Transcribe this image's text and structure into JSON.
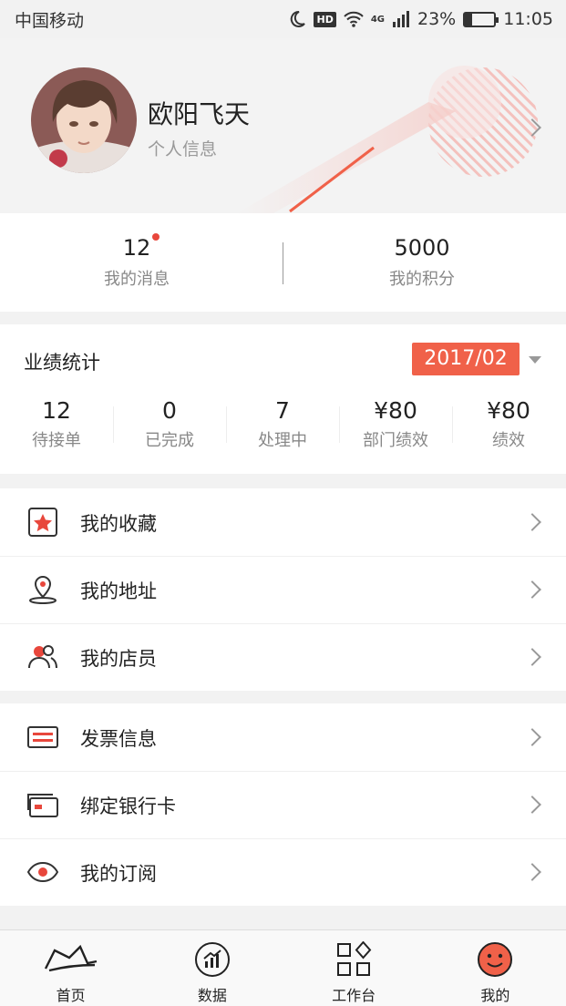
{
  "status_bar": {
    "carrier": "中国移动",
    "hd": "HD",
    "network": "4G",
    "battery_percent": "23%",
    "battery_level": 0.23,
    "time": "11:05"
  },
  "profile": {
    "name": "欧阳飞天",
    "subtitle": "个人信息"
  },
  "stats": [
    {
      "value": "12",
      "label": "我的消息",
      "has_dot": true
    },
    {
      "value": "5000",
      "label": "我的积分",
      "has_dot": false
    }
  ],
  "performance": {
    "title": "业绩统计",
    "date": "2017/02",
    "metrics": [
      {
        "value": "12",
        "label": "待接单"
      },
      {
        "value": "0",
        "label": "已完成"
      },
      {
        "value": "7",
        "label": "处理中"
      },
      {
        "value": "¥80",
        "label": "部门绩效"
      },
      {
        "value": "¥80",
        "label": "绩效"
      }
    ]
  },
  "menu_group_1": [
    {
      "label": "我的收藏",
      "icon": "star-icon"
    },
    {
      "label": "我的地址",
      "icon": "location-pin-icon"
    },
    {
      "label": "我的店员",
      "icon": "staff-icon"
    }
  ],
  "menu_group_2": [
    {
      "label": "发票信息",
      "icon": "invoice-icon"
    },
    {
      "label": "绑定银行卡",
      "icon": "bank-card-icon"
    },
    {
      "label": "我的订阅",
      "icon": "eye-icon"
    }
  ],
  "tabbar": [
    {
      "label": "首页",
      "icon": "home-hat-icon",
      "active": false
    },
    {
      "label": "数据",
      "icon": "data-chart-icon",
      "active": false
    },
    {
      "label": "工作台",
      "icon": "workbench-grid-icon",
      "active": false
    },
    {
      "label": "我的",
      "icon": "smiley-icon",
      "active": true
    }
  ],
  "colors": {
    "accent": "#f06149",
    "dot": "#e8473c",
    "text_primary": "#222222",
    "text_secondary": "#888888"
  }
}
